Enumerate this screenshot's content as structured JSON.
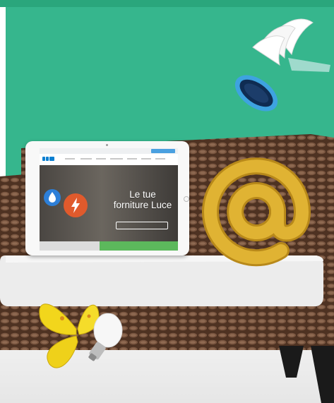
{
  "tablet": {
    "hero_line1": "Le tue",
    "hero_line2": "forniture Luce"
  },
  "colors": {
    "background_green": "#36b68d",
    "sofa_brown": "#5a3a28",
    "cushion": "#e9e9e9",
    "at_sign_gold": "#d9a928",
    "butterfly_yellow": "#f0d41e"
  },
  "icons": [
    "gas-flame-icon",
    "electricity-bolt-icon"
  ]
}
